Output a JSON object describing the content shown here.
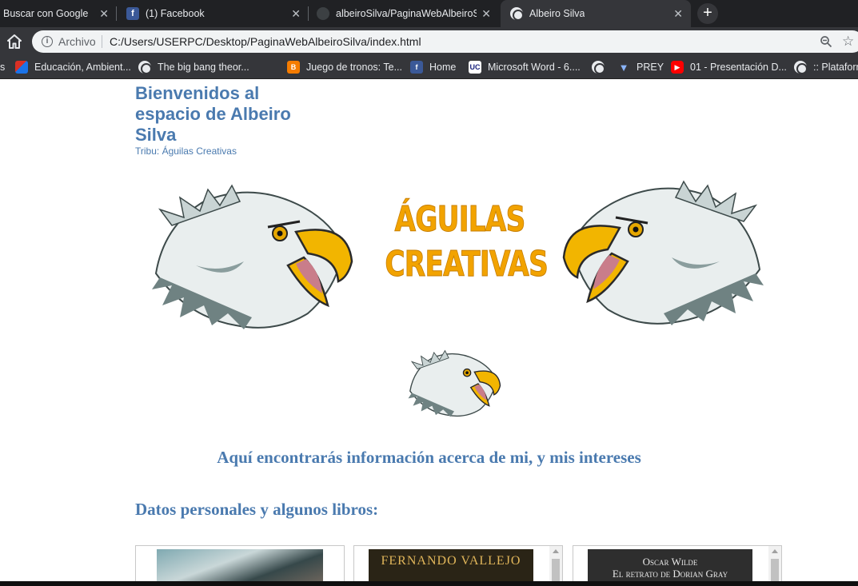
{
  "browser": {
    "tabs": [
      {
        "title": "Buscar con Google",
        "icon": "google-icon",
        "active": false
      },
      {
        "title": "(1) Facebook",
        "icon": "facebook-icon",
        "active": false
      },
      {
        "title": "albeiroSilva/PaginaWebAlbeiroSilva",
        "icon": "github-icon",
        "active": false
      },
      {
        "title": "Albeiro Silva",
        "icon": "globe-icon",
        "active": true
      }
    ],
    "new_tab": "+",
    "close_glyph": "✕",
    "omnibox": {
      "info": "i",
      "scheme": "Archivo",
      "url": "C:/Users/USERPC/Desktop/PaginaWebAlbeiroSilva/index.html"
    },
    "star": "☆",
    "bookmarks": [
      {
        "label": "s",
        "icon": "none"
      },
      {
        "label": "Educación, Ambient...",
        "icon": "edu-icon"
      },
      {
        "label": "The big bang theor...",
        "icon": "globe-icon"
      },
      {
        "label": "Juego de tronos: Te...",
        "icon": "blogger-icon"
      },
      {
        "label": "Home",
        "icon": "facebook-icon"
      },
      {
        "label": "Microsoft Word - 6....",
        "icon": "uc-icon"
      },
      {
        "label": "",
        "icon": "globe-icon"
      },
      {
        "label": "PREY",
        "icon": "prey-icon"
      },
      {
        "label": "01 - Presentación D...",
        "icon": "youtube-icon"
      },
      {
        "label": ":: Plataform",
        "icon": "globe-icon"
      }
    ]
  },
  "page": {
    "title": "Bienvenidos al espacio de Albeiro Silva",
    "subtitle": "Tribu: Águilas Creativas",
    "banner_line1": "ÁGUILAS",
    "banner_line2": "CREATIVAS",
    "intro": "Aquí encontrarás información acerca de mi, y mis intereses",
    "section_title": "Datos personales y algunos libros:",
    "cards": [
      {
        "type": "photo"
      },
      {
        "type": "book",
        "line1": "FERNANDO VALLEJO",
        "line2": ""
      },
      {
        "type": "book",
        "line1": "Oscar Wilde",
        "line2": "El retrato de Dorian Gray"
      }
    ]
  },
  "colors": {
    "accent_text": "#4a7aaf",
    "banner_orange": "#f2a300",
    "chrome_dark": "#202124",
    "chrome_mid": "#35363a"
  }
}
